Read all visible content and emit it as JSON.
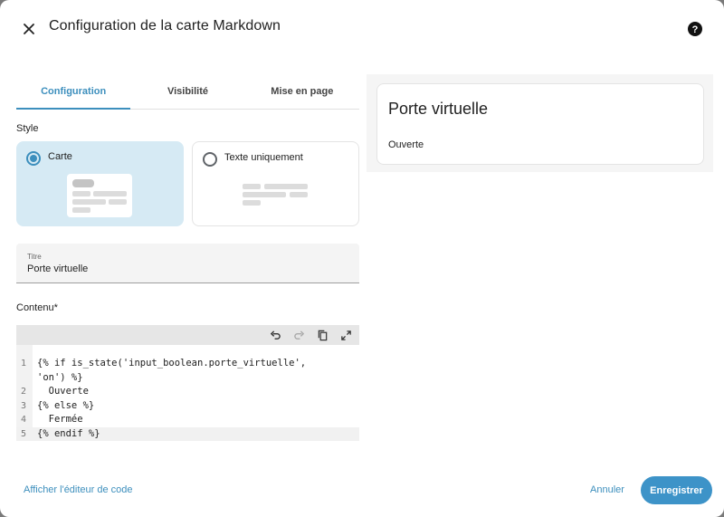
{
  "dialog": {
    "title": "Configuration de la carte Markdown"
  },
  "tabs": [
    {
      "label": "Configuration",
      "active": true
    },
    {
      "label": "Visibilité",
      "active": false
    },
    {
      "label": "Mise en page",
      "active": false
    }
  ],
  "style": {
    "label": "Style",
    "options": [
      {
        "label": "Carte",
        "selected": true
      },
      {
        "label": "Texte uniquement",
        "selected": false
      }
    ]
  },
  "title_field": {
    "label": "Titre",
    "value": "Porte virtuelle"
  },
  "content": {
    "label": "Contenu*",
    "lines": [
      {
        "number": "1",
        "text": "{% if is_state('input_boolean.porte_virtuelle',",
        "active": false
      },
      {
        "number": "",
        "text": "'on') %}",
        "active": false
      },
      {
        "number": "2",
        "text": "  Ouverte",
        "active": false
      },
      {
        "number": "3",
        "text": "{% else %}",
        "active": false
      },
      {
        "number": "4",
        "text": "  Fermée",
        "active": false
      },
      {
        "number": "5",
        "text": "{% endif %}",
        "active": true
      }
    ]
  },
  "preview": {
    "title": "Porte virtuelle",
    "body": "Ouverte"
  },
  "footer": {
    "show_code": "Afficher l'éditeur de code",
    "cancel": "Annuler",
    "save": "Enregistrer"
  },
  "colors": {
    "accent": "#3d8fbd",
    "selected_card_bg": "#d6eaf4"
  }
}
